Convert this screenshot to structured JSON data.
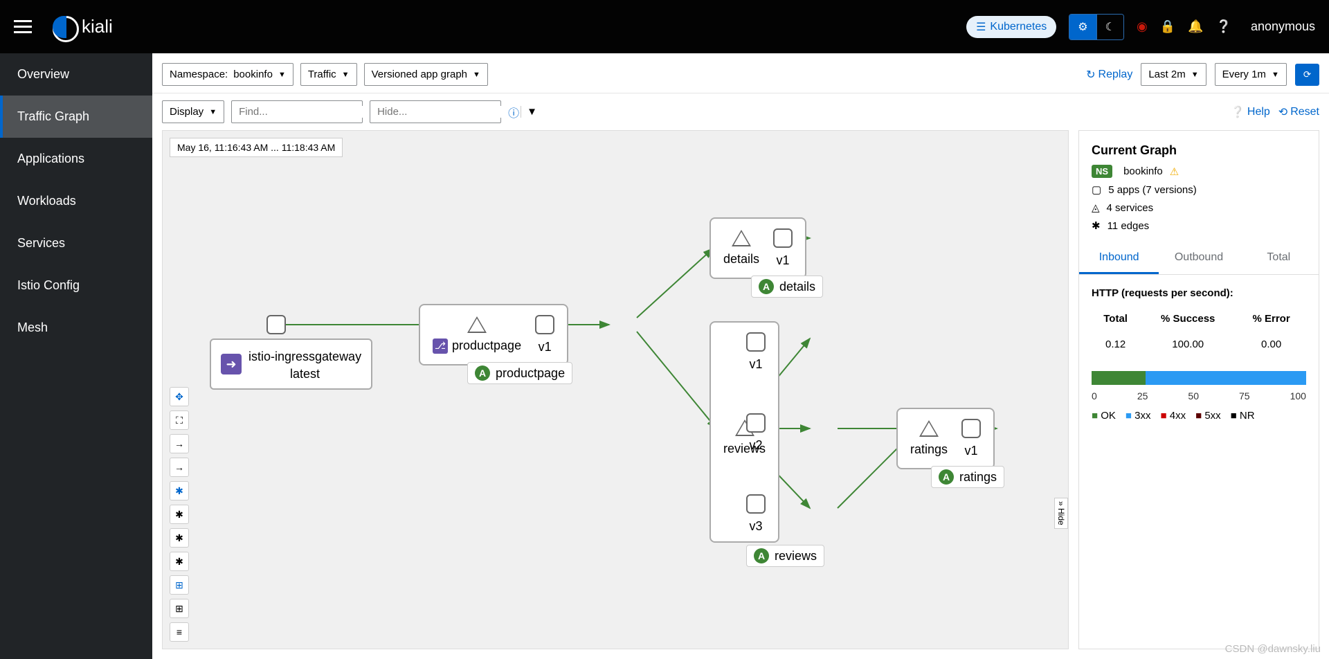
{
  "header": {
    "brand": "kiali",
    "cluster_pill": "Kubernetes",
    "user": "anonymous"
  },
  "sidebar": {
    "items": [
      {
        "label": "Overview"
      },
      {
        "label": "Traffic Graph"
      },
      {
        "label": "Applications"
      },
      {
        "label": "Workloads"
      },
      {
        "label": "Services"
      },
      {
        "label": "Istio Config"
      },
      {
        "label": "Mesh"
      }
    ],
    "active_index": 1
  },
  "toolbar": {
    "namespace_label": "Namespace:",
    "namespace_value": "bookinfo",
    "traffic": "Traffic",
    "graph_type": "Versioned app graph",
    "replay": "Replay",
    "time_range": "Last 2m",
    "refresh_interval": "Every 1m",
    "display": "Display",
    "find_placeholder": "Find...",
    "hide_placeholder": "Hide...",
    "help": "Help",
    "reset": "Reset",
    "timestamp": "May 16, 11:16:43 AM ... 11:18:43 AM"
  },
  "graph": {
    "gateway": {
      "name": "istio-ingressgateway",
      "version": "latest"
    },
    "productpage": {
      "service": "productpage",
      "vs_icon": true,
      "versions": [
        "v1"
      ],
      "app_label": "productpage"
    },
    "details": {
      "service": "details",
      "versions": [
        "v1"
      ],
      "app_label": "details"
    },
    "reviews": {
      "service": "reviews",
      "versions": [
        "v1",
        "v2",
        "v3"
      ],
      "app_label": "reviews"
    },
    "ratings": {
      "service": "ratings",
      "versions": [
        "v1"
      ],
      "app_label": "ratings"
    },
    "hide_toggle": "Hide"
  },
  "panel": {
    "title": "Current Graph",
    "ns_badge": "NS",
    "ns_name": "bookinfo",
    "apps_line": "5 apps (7 versions)",
    "services_line": "4 services",
    "edges_line": "11 edges",
    "tabs": [
      "Inbound",
      "Outbound",
      "Total"
    ],
    "active_tab": 0,
    "http_header": "HTTP (requests per second):",
    "table": {
      "headers": [
        "Total",
        "% Success",
        "% Error"
      ],
      "row": [
        "0.12",
        "100.00",
        "0.00"
      ]
    },
    "legend": [
      "OK",
      "3xx",
      "4xx",
      "5xx",
      "NR"
    ]
  },
  "chart_data": {
    "type": "bar",
    "orientation": "horizontal-stacked",
    "title": "",
    "x_ticks": [
      0,
      25,
      50,
      75,
      100
    ],
    "series": [
      {
        "name": "OK",
        "value": 25,
        "color": "#3e8635"
      },
      {
        "name": "3xx",
        "value": 75,
        "color": "#2b9af3"
      },
      {
        "name": "4xx",
        "value": 0,
        "color": "#cc0000"
      },
      {
        "name": "5xx",
        "value": 0,
        "color": "#5c0000"
      },
      {
        "name": "NR",
        "value": 0,
        "color": "#000000"
      }
    ],
    "xlim": [
      0,
      100
    ]
  },
  "watermark": "CSDN @dawnsky.liu"
}
